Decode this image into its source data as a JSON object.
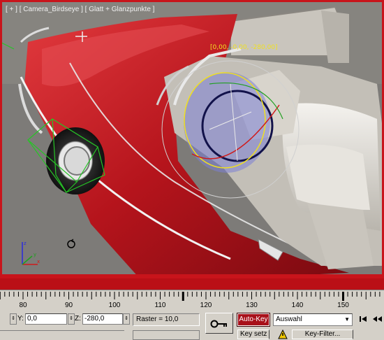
{
  "viewport": {
    "label": "[ + ] [ Camera_Birdseye ] [ Glatt + Glanzpunkte ]",
    "coordinate_readout": "[0,00, -0,00, -280,00]"
  },
  "timeline": {
    "ticks": [
      "80",
      "90",
      "100",
      "110",
      "120",
      "130",
      "140",
      "150"
    ],
    "current_frame_marker": 115
  },
  "coordinates": {
    "y_label": "Y:",
    "y_value": "0,0",
    "z_label": "Z:",
    "z_value": "-280,0"
  },
  "grid": {
    "label": "Raster = 10,0"
  },
  "animation": {
    "autokey_label": "Auto-Key",
    "selection_value": "Auswahl",
    "keysetzen_label": "Key setz",
    "keyfilter_label": "Key-Filter..."
  },
  "icons": {
    "key": "key-icon",
    "playback_start": "go-to-start-icon",
    "prev_frame": "previous-frame-icon",
    "warning": "warning-icon",
    "axis_tripod": "axis-tripod-icon",
    "cursor": "rotate-cursor-icon"
  },
  "colors": {
    "autokey_active": "#a8101a",
    "viewport_border": "#c8141b",
    "car_body": "#b9161f",
    "gizmo_yellow": "#f0e020"
  }
}
